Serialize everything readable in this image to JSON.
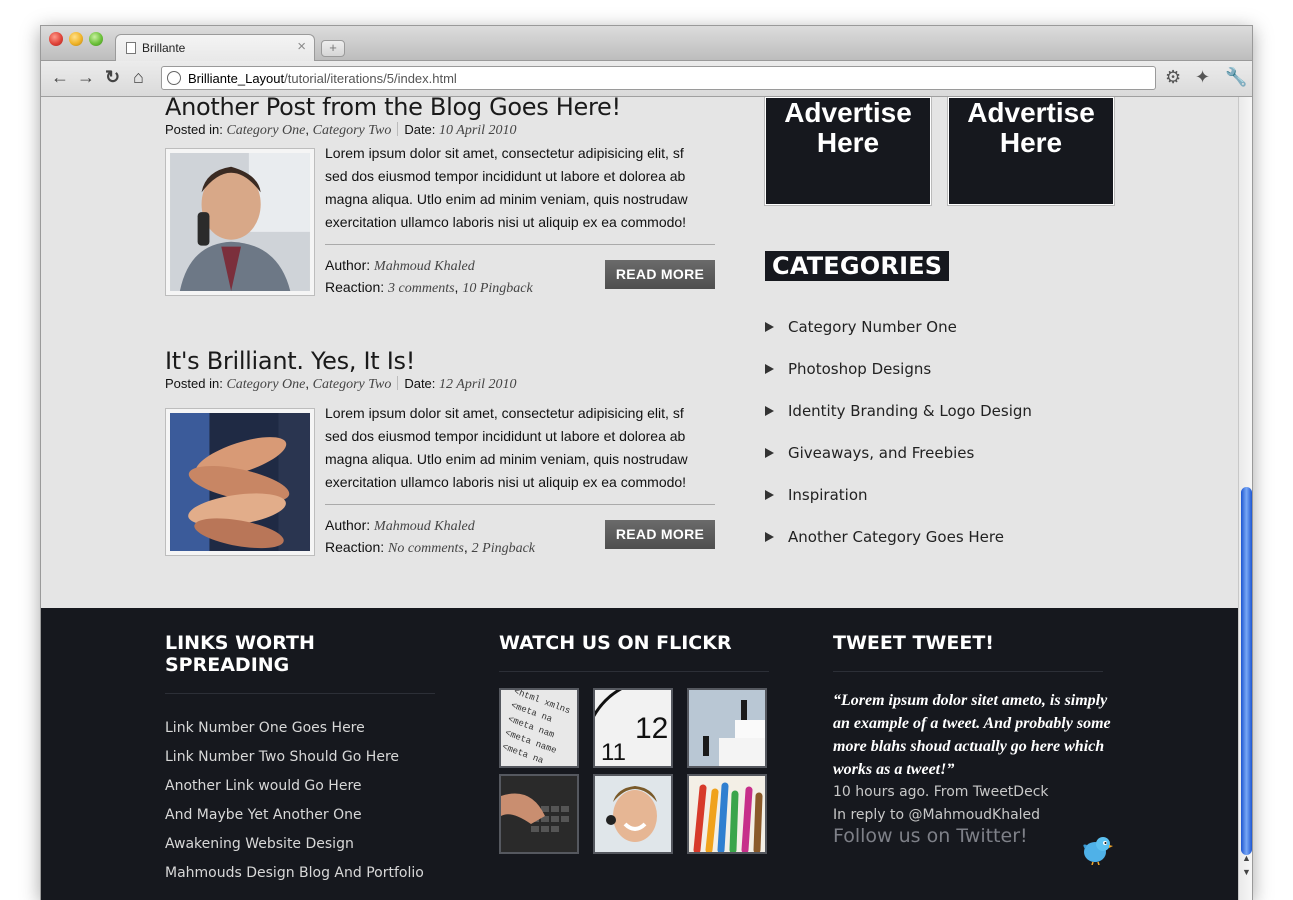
{
  "browser": {
    "tab_title": "Brillante",
    "tab_close": "×",
    "new_tab": "+",
    "url_host": "Brilliante_Layout",
    "url_path": "/tutorial/iterations/5/index.html"
  },
  "posts": [
    {
      "title": "Another Post from the Blog Goes Here!",
      "posted_in_label": "Posted in:",
      "category_one": "Category One",
      "category_two": "Category Two",
      "date_label": "Date:",
      "date": "10 April 2010",
      "excerpt": "Lorem ipsum dolor sit amet, consectetur adipisicing elit, sf sed dos eiusmod tempor incididunt ut labore et dolorea ab magna aliqua. Utlo enim ad minim veniam, quis nostrudaw exercitation ullamco laboris nisi ut aliquip ex ea commodo!",
      "author_label": "Author:",
      "author": "Mahmoud Khaled",
      "reaction_label": "Reaction:",
      "comments": "3 comments",
      "pingbacks": "10 Pingback",
      "read_more": "READ MORE"
    },
    {
      "title": "It's Brilliant. Yes, It Is!",
      "posted_in_label": "Posted in:",
      "category_one": "Category One",
      "category_two": "Category Two",
      "date_label": "Date:",
      "date": "12 April 2010",
      "excerpt": "Lorem ipsum dolor sit amet, consectetur adipisicing elit, sf sed dos eiusmod tempor incididunt ut labore et dolorea ab magna aliqua. Utlo enim ad minim veniam, quis nostrudaw exercitation ullamco laboris nisi ut aliquip ex ea commodo!",
      "author_label": "Author:",
      "author": "Mahmoud Khaled",
      "reaction_label": "Reaction:",
      "comments": "No comments",
      "pingbacks": "2 Pingback",
      "read_more": "READ MORE"
    }
  ],
  "ads": [
    {
      "line1": "Advertise",
      "line2": "Here"
    },
    {
      "line1": "Advertise",
      "line2": "Here"
    }
  ],
  "categories": {
    "title": "CATEGORIES",
    "items": [
      "Category Number One",
      "Photoshop Designs",
      "Identity Branding & Logo Design",
      "Giveaways, and Freebies",
      "Inspiration",
      "Another Category Goes Here"
    ]
  },
  "footer": {
    "links_title": "LINKS WORTH SPREADING",
    "links": [
      "Link Number One Goes Here",
      "Link Number Two Should Go Here",
      "Another Link would Go Here",
      "And Maybe Yet Another One",
      "Awakening Website Design",
      "Mahmouds Design Blog And Portfolio"
    ],
    "flickr_title": "WATCH US ON FLICKR",
    "tweet_title": "TWEET TWEET!",
    "tweet_text": "“Lorem ipsum dolor sitet ameto, is simply an example of a tweet. And probably some more blahs shoud actually go here which works as a tweet!”",
    "tweet_time": "10 hours ago. From TweetDeck",
    "tweet_reply": "In reply to @MahmoudKhaled",
    "follow": "Follow us on Twitter!"
  }
}
